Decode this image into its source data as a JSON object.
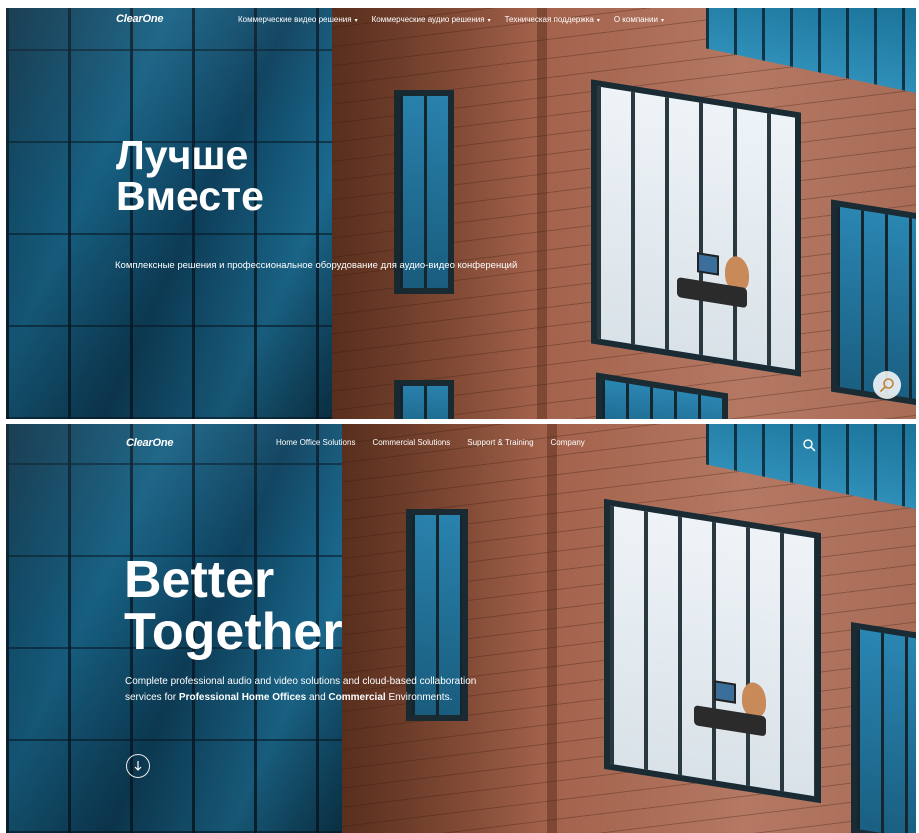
{
  "ru": {
    "logo": "ClearOne",
    "menu": [
      {
        "label": "Коммерческие видео решения"
      },
      {
        "label": "Коммерческие аудио решения"
      },
      {
        "label": "Техническая поддержка"
      },
      {
        "label": "О компании"
      }
    ],
    "hero_title_line1": "Лучше",
    "hero_title_line2": "Вместе",
    "hero_subtitle": "Комплексные решения и профессиональное оборудование для аудио-видео конференций"
  },
  "en": {
    "logo": "ClearOne",
    "menu": [
      {
        "label": "Home Office Solutions"
      },
      {
        "label": "Commercial Solutions"
      },
      {
        "label": "Support & Training"
      },
      {
        "label": "Company"
      }
    ],
    "hero_title_line1": "Better",
    "hero_title_line2": "Together",
    "hero_subtitle_part1": "Complete professional audio and video solutions and cloud-based collaboration services for ",
    "hero_subtitle_bold1": "Professional Home Offices",
    "hero_subtitle_part2": " and ",
    "hero_subtitle_bold2": "Commercial",
    "hero_subtitle_part3": " Environments."
  },
  "colors": {
    "nav_text": "#ffffff",
    "glass": "#1a6d94",
    "brick": "#a2614a"
  }
}
